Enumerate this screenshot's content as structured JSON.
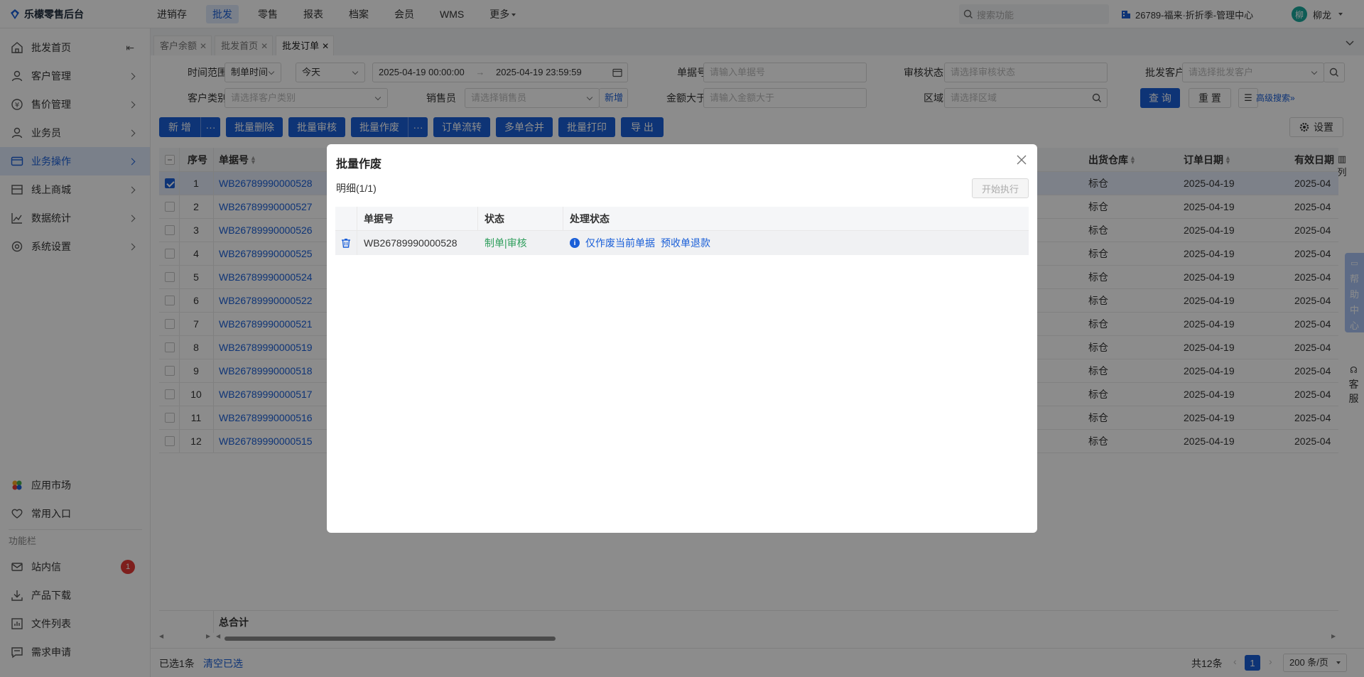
{
  "app": {
    "title": "乐檬零售后台"
  },
  "topnav": {
    "items": [
      {
        "label": "进销存",
        "active": false
      },
      {
        "label": "批发",
        "active": true
      },
      {
        "label": "零售",
        "active": false
      },
      {
        "label": "报表",
        "active": false
      },
      {
        "label": "档案",
        "active": false
      },
      {
        "label": "会员",
        "active": false
      },
      {
        "label": "WMS",
        "active": false
      },
      {
        "label": "更多",
        "active": false
      }
    ],
    "search_placeholder": "搜索功能",
    "store": "26789-福来·折折季-管理中心",
    "user_avatar": "柳",
    "user_name": "柳龙"
  },
  "sidebar": {
    "items": [
      {
        "label": "批发首页",
        "icon": "home-icon"
      },
      {
        "label": "客户管理",
        "icon": "user-icon"
      },
      {
        "label": "售价管理",
        "icon": "price-icon"
      },
      {
        "label": "业务员",
        "icon": "user-icon"
      },
      {
        "label": "业务操作",
        "icon": "card-icon",
        "active": true
      },
      {
        "label": "线上商城",
        "icon": "shop-icon"
      },
      {
        "label": "数据统计",
        "icon": "chart-icon"
      },
      {
        "label": "系统设置",
        "icon": "gear-icon"
      }
    ],
    "app_market": "应用市场",
    "favorites": "常用入口",
    "section_title": "功能栏",
    "bottom_items": [
      {
        "label": "站内信",
        "badge": "1"
      },
      {
        "label": "产品下载"
      },
      {
        "label": "文件列表"
      },
      {
        "label": "需求申请"
      }
    ]
  },
  "tabs": [
    {
      "label": "客户余额",
      "active": false
    },
    {
      "label": "批发首页",
      "active": false
    },
    {
      "label": "批发订单",
      "active": true
    }
  ],
  "filters": {
    "time_range_label": "时间范围",
    "time_type": "制单时间",
    "period": "今天",
    "start": "2025-04-19 00:00:00",
    "end": "2025-04-19 23:59:59",
    "order_no_label": "单据号",
    "order_no_placeholder": "请输入单据号",
    "audit_label": "审核状态",
    "audit_placeholder": "请选择审核状态",
    "customer_label": "批发客户",
    "customer_placeholder": "请选择批发客户",
    "cust_type_label": "客户类别",
    "cust_type_placeholder": "请选择客户类别",
    "salesman_label": "销售员",
    "salesman_placeholder": "请选择销售员",
    "add_label": "新增",
    "amount_label": "金额大于",
    "amount_placeholder": "请输入金额大于",
    "region_label": "区域",
    "region_placeholder": "请选择区域",
    "query": "查 询",
    "reset": "重 置",
    "advanced": "高级搜索"
  },
  "toolbar": {
    "add": "新 增",
    "more": "···",
    "batch_delete": "批量删除",
    "batch_audit": "批量审核",
    "batch_void": "批量作废",
    "flow": "订单流转",
    "merge": "多单合并",
    "print": "批量打印",
    "export": "导 出",
    "settings": "设置"
  },
  "table": {
    "headers": {
      "seq": "序号",
      "order_no": "单据号",
      "warehouse": "出货仓库",
      "order_date": "订单日期",
      "valid_date": "有效日期"
    },
    "col_toggle": "列",
    "rows": [
      {
        "seq": "1",
        "order_no": "WB26789990000528",
        "warehouse": "标仓",
        "order_date": "2025-04-19",
        "valid_date": "2025-04",
        "checked": true
      },
      {
        "seq": "2",
        "order_no": "WB26789990000527",
        "warehouse": "标仓",
        "order_date": "2025-04-19",
        "valid_date": "2025-04"
      },
      {
        "seq": "3",
        "order_no": "WB26789990000526",
        "warehouse": "标仓",
        "order_date": "2025-04-19",
        "valid_date": "2025-04"
      },
      {
        "seq": "4",
        "order_no": "WB26789990000525",
        "warehouse": "标仓",
        "order_date": "2025-04-19",
        "valid_date": "2025-04"
      },
      {
        "seq": "5",
        "order_no": "WB26789990000524",
        "warehouse": "标仓",
        "order_date": "2025-04-19",
        "valid_date": "2025-04"
      },
      {
        "seq": "6",
        "order_no": "WB26789990000522",
        "warehouse": "标仓",
        "order_date": "2025-04-19",
        "valid_date": "2025-04"
      },
      {
        "seq": "7",
        "order_no": "WB26789990000521",
        "warehouse": "标仓",
        "order_date": "2025-04-19",
        "valid_date": "2025-04"
      },
      {
        "seq": "8",
        "order_no": "WB26789990000519",
        "warehouse": "标仓",
        "order_date": "2025-04-19",
        "valid_date": "2025-04"
      },
      {
        "seq": "9",
        "order_no": "WB26789990000518",
        "warehouse": "标仓",
        "order_date": "2025-04-19",
        "valid_date": "2025-04"
      },
      {
        "seq": "10",
        "order_no": "WB26789990000517",
        "warehouse": "标仓",
        "order_date": "2025-04-19",
        "valid_date": "2025-04"
      },
      {
        "seq": "11",
        "order_no": "WB26789990000516",
        "warehouse": "标仓",
        "order_date": "2025-04-19",
        "valid_date": "2025-04"
      },
      {
        "seq": "12",
        "order_no": "WB26789990000515",
        "warehouse": "标仓",
        "order_date": "2025-04-19",
        "valid_date": "2025-04"
      }
    ],
    "summary_label": "总合计"
  },
  "footer": {
    "selected": "已选1条",
    "clear": "清空已选",
    "total": "共12条",
    "page": "1",
    "page_size": "200 条/页"
  },
  "modal": {
    "title": "批量作废",
    "detail": "明细(1/1)",
    "run": "开始执行",
    "headers": {
      "order_no": "单据号",
      "status": "状态",
      "process": "处理状态"
    },
    "row": {
      "order_no": "WB26789990000528",
      "status": "制单|审核",
      "option1": "仅作废当前单据",
      "option2": "预收单退款"
    }
  },
  "float": {
    "help": [
      "帮",
      "助",
      "中",
      "心"
    ],
    "cs": [
      "客",
      "服"
    ]
  },
  "colors": {
    "primary": "#1a5fd8",
    "success": "#2f9e5c",
    "badge": "#e53935"
  }
}
